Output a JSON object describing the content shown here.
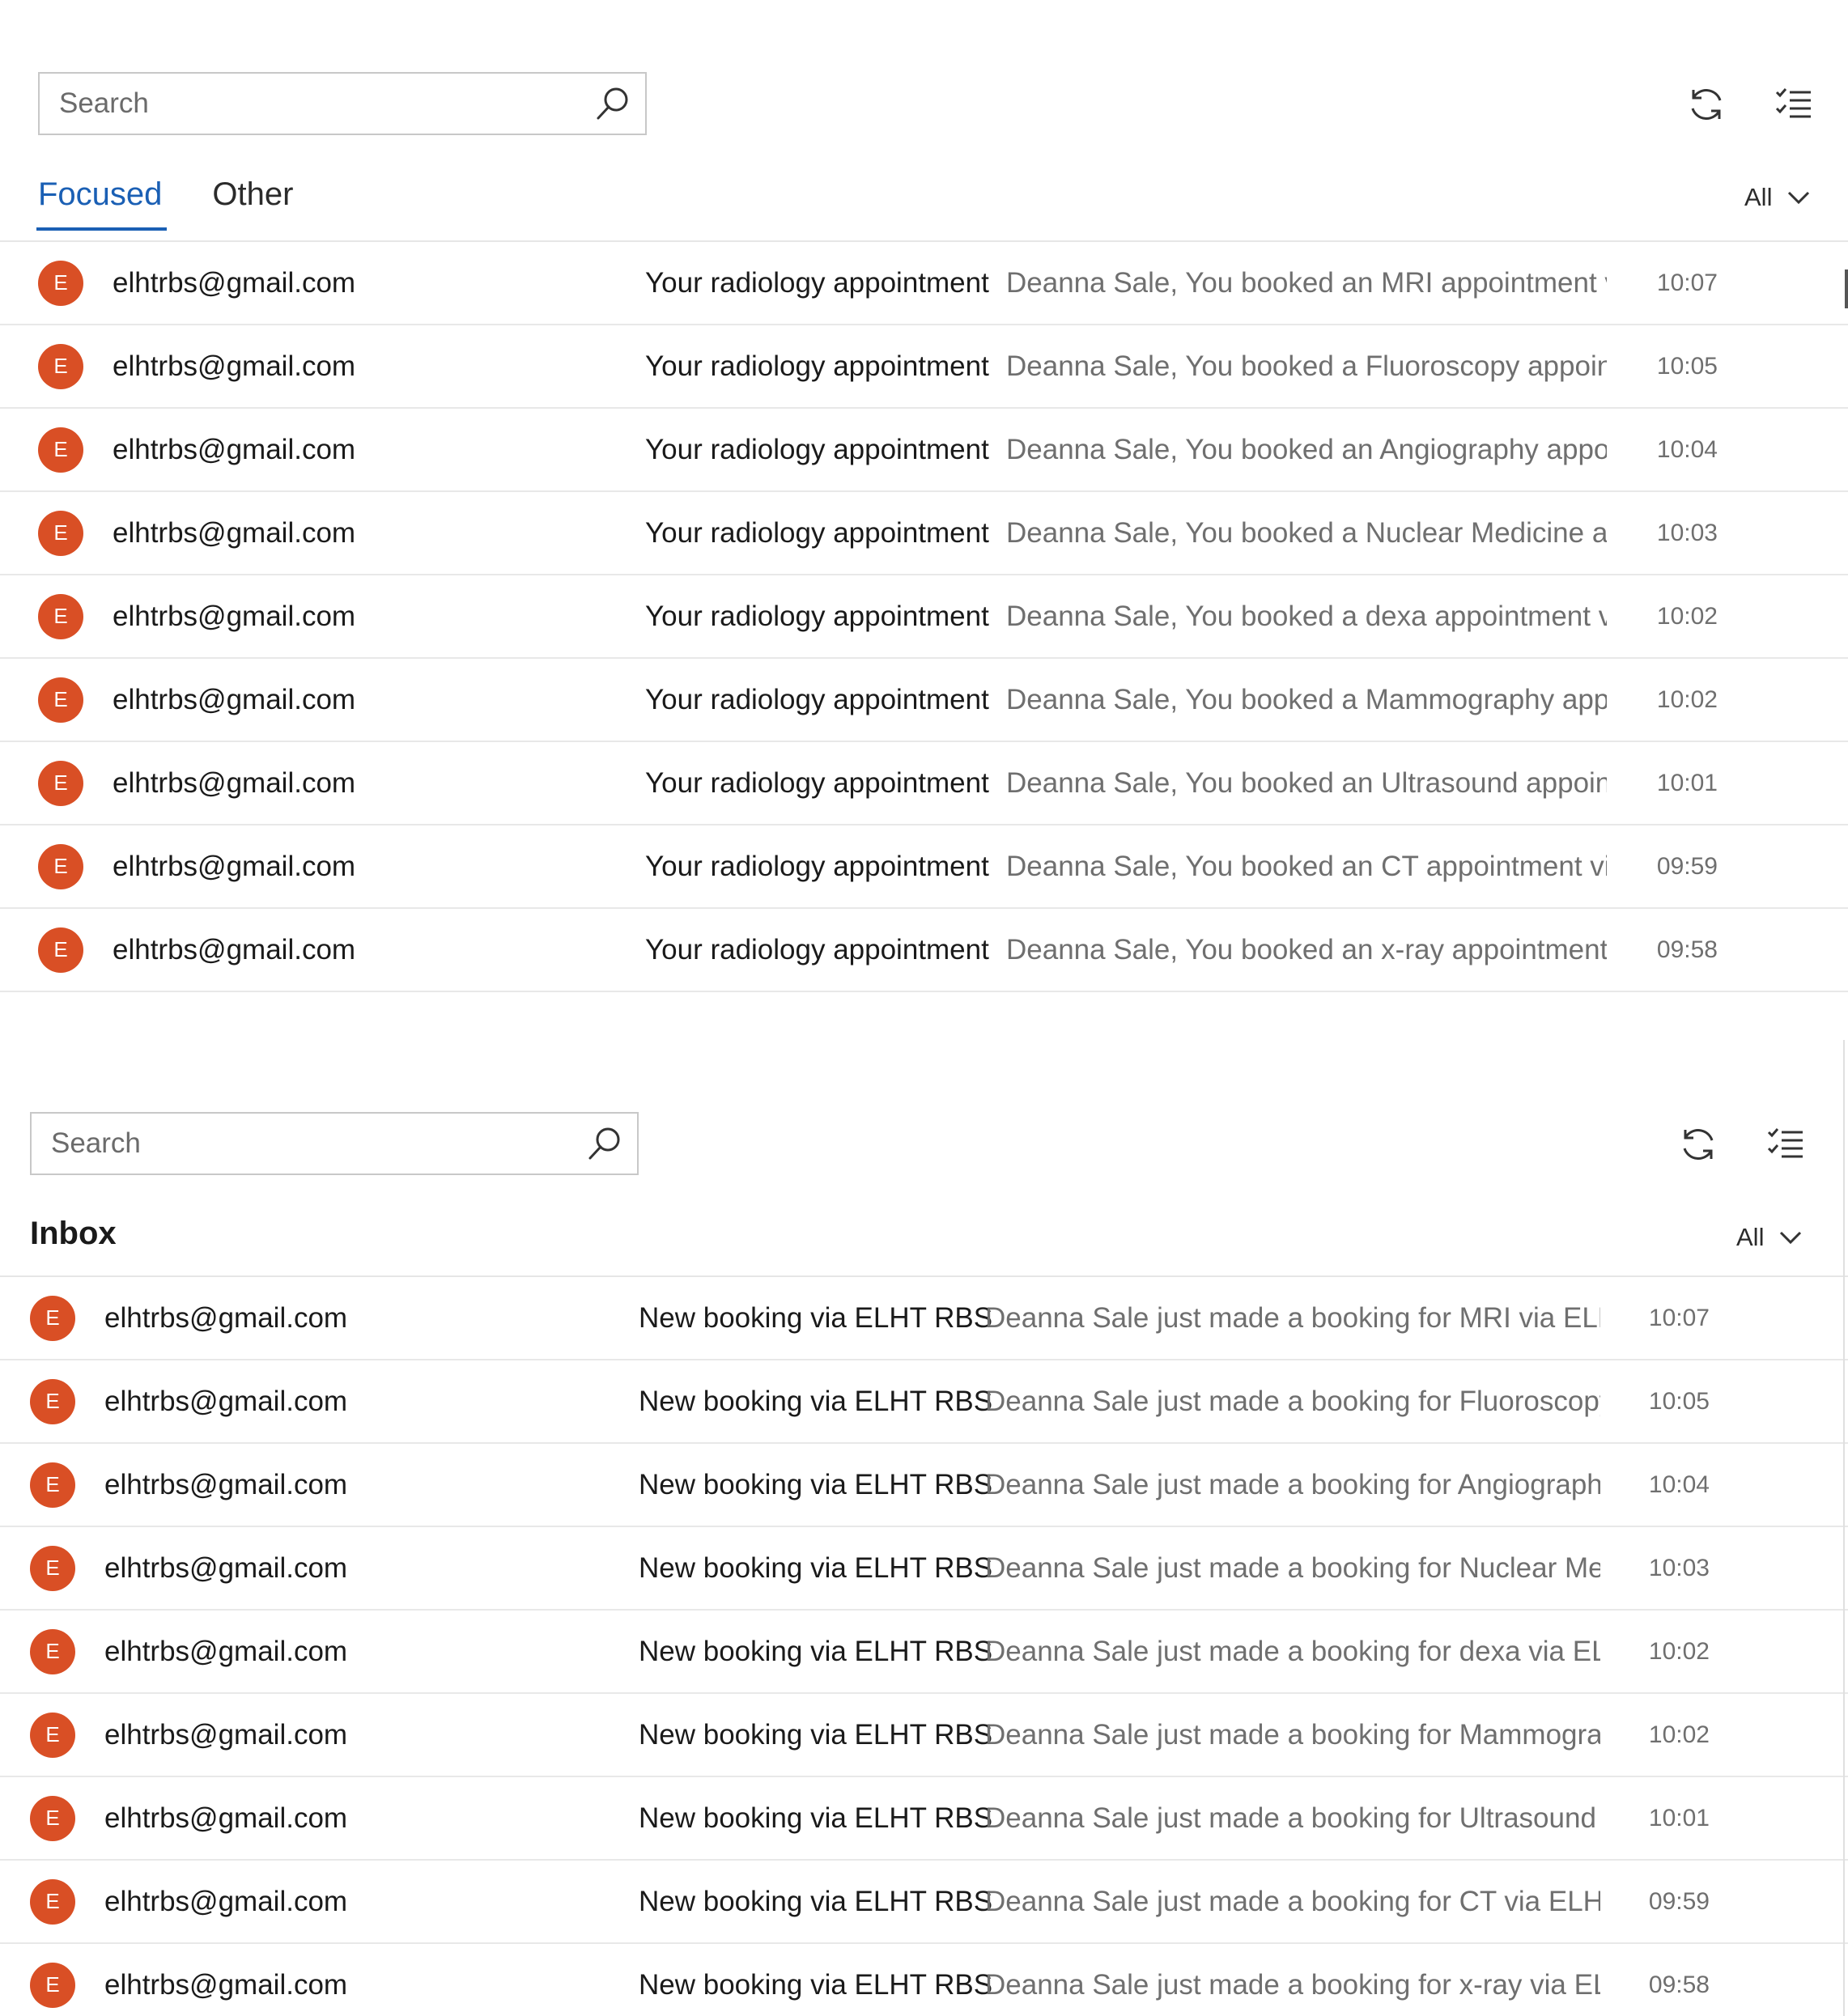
{
  "top_panel": {
    "search": {
      "placeholder": "Search"
    },
    "tabs": [
      {
        "label": "Focused",
        "active": true
      },
      {
        "label": "Other",
        "active": false
      }
    ],
    "filter_label": "All",
    "messages": [
      {
        "avatar": "E",
        "sender": "elhtrbs@gmail.com",
        "subject": "Your radiology appointment",
        "preview": "Deanna Sale, You booked an MRI appointment vi",
        "time": "10:07"
      },
      {
        "avatar": "E",
        "sender": "elhtrbs@gmail.com",
        "subject": "Your radiology appointment",
        "preview": "Deanna Sale, You booked a Fluoroscopy appointr",
        "time": "10:05"
      },
      {
        "avatar": "E",
        "sender": "elhtrbs@gmail.com",
        "subject": "Your radiology appointment",
        "preview": "Deanna Sale, You booked an Angiography appoir",
        "time": "10:04"
      },
      {
        "avatar": "E",
        "sender": "elhtrbs@gmail.com",
        "subject": "Your radiology appointment",
        "preview": "Deanna Sale, You booked a Nuclear Medicine ap",
        "time": "10:03"
      },
      {
        "avatar": "E",
        "sender": "elhtrbs@gmail.com",
        "subject": "Your radiology appointment",
        "preview": "Deanna Sale, You booked a dexa appointment vi",
        "time": "10:02"
      },
      {
        "avatar": "E",
        "sender": "elhtrbs@gmail.com",
        "subject": "Your radiology appointment",
        "preview": "Deanna Sale, You booked a Mammography appo",
        "time": "10:02"
      },
      {
        "avatar": "E",
        "sender": "elhtrbs@gmail.com",
        "subject": "Your radiology appointment",
        "preview": "Deanna Sale, You booked an Ultrasound appointr",
        "time": "10:01"
      },
      {
        "avatar": "E",
        "sender": "elhtrbs@gmail.com",
        "subject": "Your radiology appointment",
        "preview": "Deanna Sale, You booked an CT appointment via",
        "time": "09:59"
      },
      {
        "avatar": "E",
        "sender": "elhtrbs@gmail.com",
        "subject": "Your radiology appointment",
        "preview": "Deanna Sale, You booked an x-ray appointment v",
        "time": "09:58"
      }
    ]
  },
  "bottom_panel": {
    "search": {
      "placeholder": "Search"
    },
    "heading": "Inbox",
    "filter_label": "All",
    "messages": [
      {
        "avatar": "E",
        "sender": "elhtrbs@gmail.com",
        "subject": "New booking via ELHT RBS",
        "preview": "Deanna Sale just made a booking for MRI via ELHT",
        "time": "10:07"
      },
      {
        "avatar": "E",
        "sender": "elhtrbs@gmail.com",
        "subject": "New booking via ELHT RBS",
        "preview": "Deanna Sale just made a booking for Fluoroscopy",
        "time": "10:05"
      },
      {
        "avatar": "E",
        "sender": "elhtrbs@gmail.com",
        "subject": "New booking via ELHT RBS",
        "preview": "Deanna Sale just made a booking for Angiography",
        "time": "10:04"
      },
      {
        "avatar": "E",
        "sender": "elhtrbs@gmail.com",
        "subject": "New booking via ELHT RBS",
        "preview": "Deanna Sale just made a booking for Nuclear Mec",
        "time": "10:03"
      },
      {
        "avatar": "E",
        "sender": "elhtrbs@gmail.com",
        "subject": "New booking via ELHT RBS",
        "preview": "Deanna Sale just made a booking for dexa via ELH",
        "time": "10:02"
      },
      {
        "avatar": "E",
        "sender": "elhtrbs@gmail.com",
        "subject": "New booking via ELHT RBS",
        "preview": "Deanna Sale just made a booking for Mammograp",
        "time": "10:02"
      },
      {
        "avatar": "E",
        "sender": "elhtrbs@gmail.com",
        "subject": "New booking via ELHT RBS",
        "preview": "Deanna Sale just made a booking for Ultrasound v",
        "time": "10:01"
      },
      {
        "avatar": "E",
        "sender": "elhtrbs@gmail.com",
        "subject": "New booking via ELHT RBS",
        "preview": "Deanna Sale just made a booking for CT via ELHT",
        "time": "09:59"
      },
      {
        "avatar": "E",
        "sender": "elhtrbs@gmail.com",
        "subject": "New booking via ELHT RBS",
        "preview": "Deanna Sale just made a booking for x-ray via ELH",
        "time": "09:58"
      }
    ]
  },
  "icons": {
    "search": "search-icon",
    "refresh": "refresh-icon",
    "select": "select-mode-icon",
    "chevron": "chevron-down-icon"
  },
  "colors": {
    "accent": "#1a5fb4",
    "avatar": "#d94f25"
  }
}
